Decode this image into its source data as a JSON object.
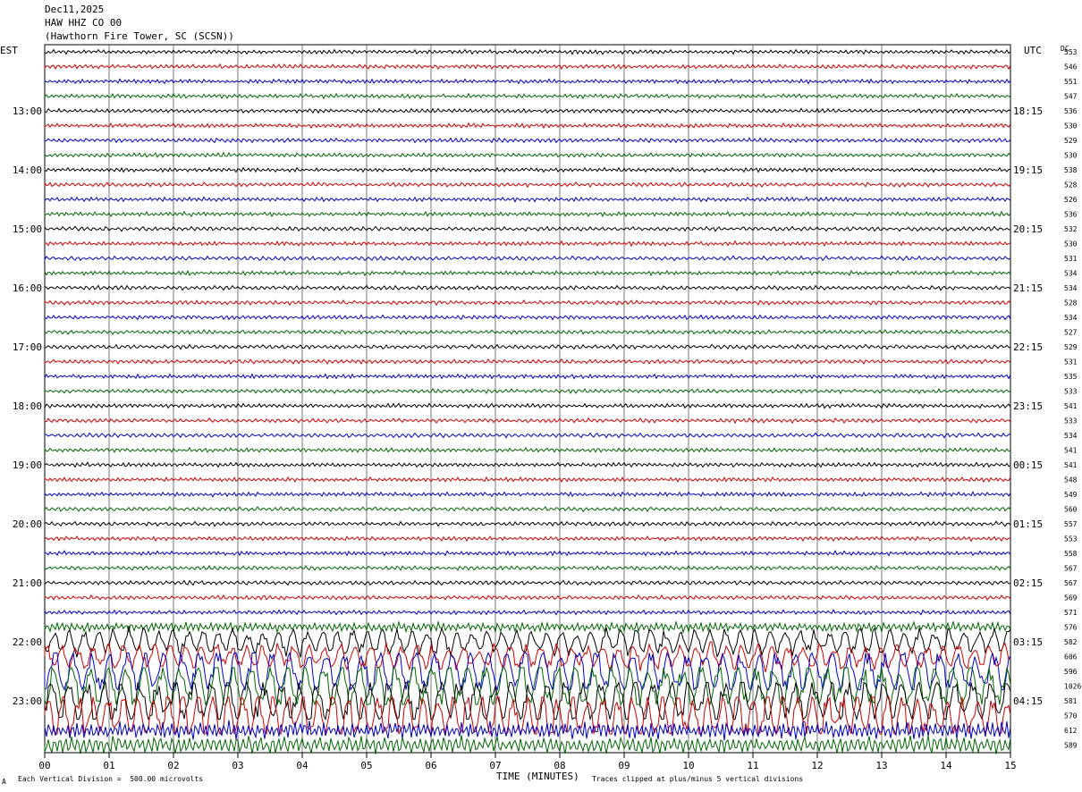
{
  "header": {
    "date": "Dec11,2025",
    "channel": "HAW HHZ CO 00",
    "station": "(Hawthorn Fire Tower, SC (SCSN))"
  },
  "left_timezone": "EST",
  "right_timezone": "UTC",
  "dc_label": "DC",
  "footer": {
    "scale_note": "Each Vertical Division =  500.00 microvolts",
    "clip_note": "Traces clipped at plus/minus 5 vertical divisions",
    "corner_mark": "A"
  },
  "chart_data": {
    "type": "line",
    "xlabel": "TIME (MINUTES)",
    "xlim": [
      0,
      15
    ],
    "x_ticks": [
      "00",
      "01",
      "02",
      "03",
      "04",
      "05",
      "06",
      "07",
      "08",
      "09",
      "10",
      "11",
      "12",
      "13",
      "14",
      "15"
    ],
    "trace_colors": [
      "#000000",
      "#cc0000",
      "#0000cc",
      "#006600"
    ],
    "est_hour_labels": [
      "13:00",
      "14:00",
      "15:00",
      "16:00",
      "17:00",
      "18:00",
      "19:00",
      "20:00",
      "21:00",
      "22:00",
      "23:00"
    ],
    "utc_hour_labels": [
      "18:15",
      "19:15",
      "20:15",
      "21:15",
      "22:15",
      "23:15",
      "00:15",
      "01:15",
      "02:15",
      "03:15",
      "04:15"
    ],
    "dc_offsets": [
      553,
      546,
      551,
      547,
      536,
      530,
      529,
      530,
      538,
      528,
      526,
      536,
      532,
      530,
      531,
      534,
      534,
      528,
      534,
      527,
      529,
      531,
      535,
      533,
      541,
      533,
      534,
      541,
      541,
      548,
      549,
      560,
      557,
      553,
      558,
      567,
      567,
      569,
      571,
      576,
      582,
      606,
      596,
      1026,
      581,
      570,
      612,
      589
    ],
    "clip_divisions": 5
  }
}
